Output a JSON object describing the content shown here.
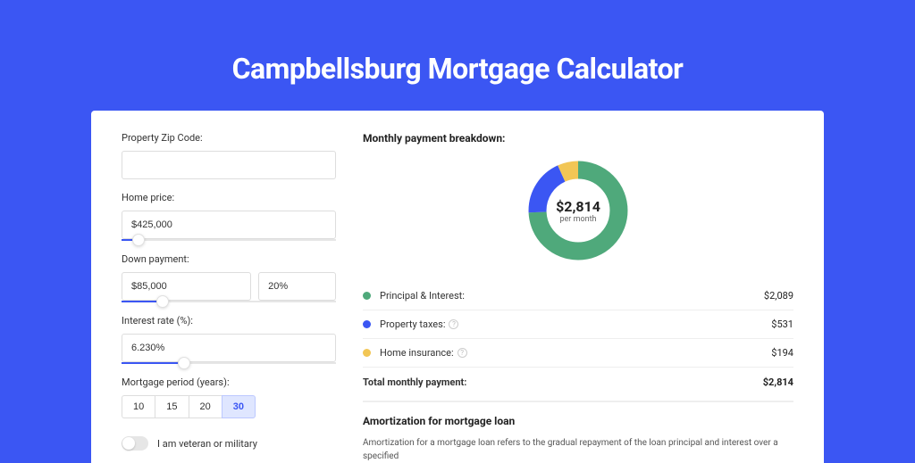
{
  "title": "Campbellsburg Mortgage Calculator",
  "form": {
    "zip": {
      "label": "Property Zip Code:",
      "value": ""
    },
    "home_price": {
      "label": "Home price:",
      "value": "$425,000",
      "slider_pct": 8
    },
    "down_payment": {
      "label": "Down payment:",
      "value": "$85,000",
      "pct": "20%",
      "slider_pct": 19
    },
    "interest": {
      "label": "Interest rate (%):",
      "value": "6.230%",
      "slider_pct": 29
    },
    "period": {
      "label": "Mortgage period (years):",
      "options": [
        "10",
        "15",
        "20",
        "30"
      ],
      "selected": "30"
    },
    "veteran": {
      "label": "I am veteran or military",
      "on": false
    }
  },
  "breakdown": {
    "title": "Monthly payment breakdown:",
    "total": "$2,814",
    "sub": "per month",
    "items": [
      {
        "name": "Principal & Interest:",
        "value": "$2,089",
        "color": "#4FA97B",
        "info": false
      },
      {
        "name": "Property taxes:",
        "value": "$531",
        "color": "#3B56F3",
        "info": true
      },
      {
        "name": "Home insurance:",
        "value": "$194",
        "color": "#F2C655",
        "info": true
      }
    ],
    "total_row": {
      "label": "Total monthly payment:",
      "value": "$2,814"
    }
  },
  "chart_data": {
    "type": "pie",
    "title": "Monthly payment breakdown",
    "series": [
      {
        "name": "Principal & Interest",
        "value": 2089,
        "color": "#4FA97B"
      },
      {
        "name": "Property taxes",
        "value": 531,
        "color": "#3B56F3"
      },
      {
        "name": "Home insurance",
        "value": 194,
        "color": "#F2C655"
      }
    ],
    "total": 2814,
    "center_label": "$2,814",
    "center_sublabel": "per month"
  },
  "amortization": {
    "title": "Amortization for mortgage loan",
    "text": "Amortization for a mortgage loan refers to the gradual repayment of the loan principal and interest over a specified"
  }
}
